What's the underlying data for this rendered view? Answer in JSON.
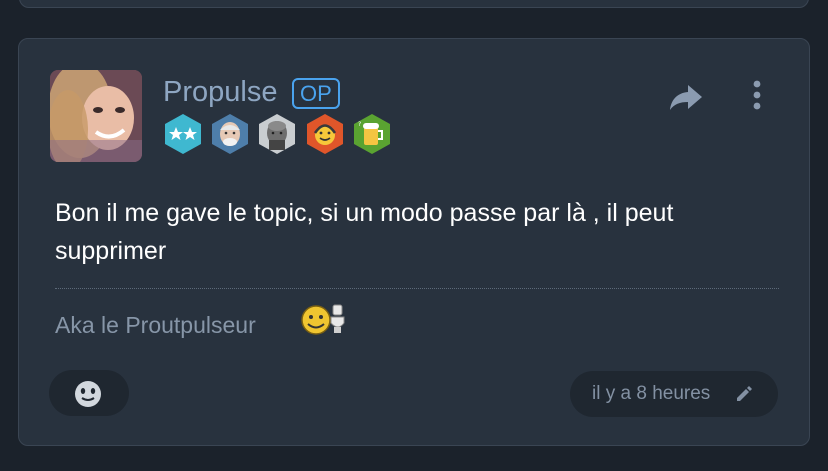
{
  "post": {
    "author": "Propulse",
    "op_label": "OP",
    "message": "Bon il me gave le topic, si un modo passe par là , il peut supprimer",
    "signature": "Aka le Proutpulseur",
    "timestamp": "il y a 8 heures"
  },
  "badges": [
    {
      "icon": "two-stars-badge-icon",
      "color": "#3fb8d0"
    },
    {
      "icon": "hide-the-pain-harold-badge-icon",
      "color": "#4e7eaa"
    },
    {
      "icon": "bald-man-portrait-badge-icon",
      "color": "#9aa2a8"
    },
    {
      "icon": "smiley-headset-badge-icon",
      "color": "#e0562a"
    },
    {
      "icon": "beer-mug-badge-icon",
      "color": "#5aa331"
    }
  ],
  "colors": {
    "background": "#1b222b",
    "card": "#28323e",
    "card_border": "#3a4553",
    "username": "#8ea6c2",
    "op_accent": "#4aa3ee",
    "message_text": "#ffffff",
    "muted_text": "#8796a8",
    "pill": "#1f2730"
  }
}
